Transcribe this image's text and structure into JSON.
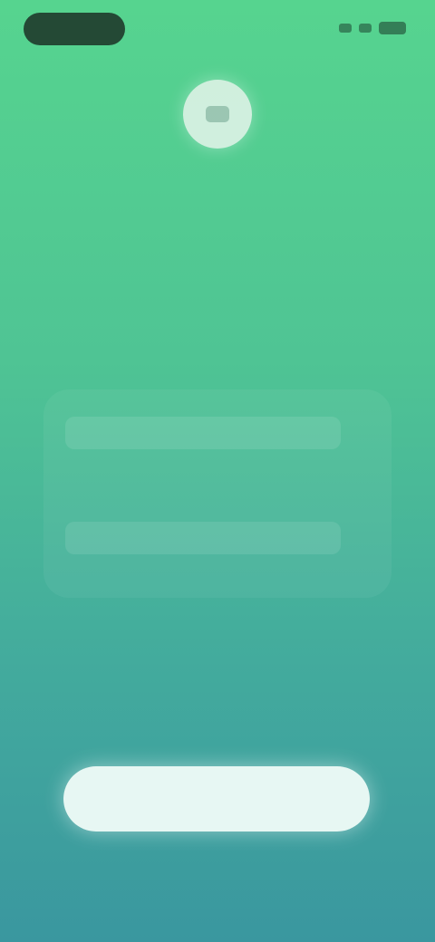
{
  "colors": {
    "gradient_top": "#56d48f",
    "gradient_bottom": "#3a979f",
    "button_bg": "#f0fcf8"
  },
  "header": {
    "logo_icon": "app-logo-icon",
    "text": ""
  },
  "form": {
    "field_1": {
      "value": "",
      "placeholder": ""
    },
    "field_2": {
      "value": "",
      "placeholder": ""
    }
  },
  "primary_button": {
    "label": ""
  }
}
